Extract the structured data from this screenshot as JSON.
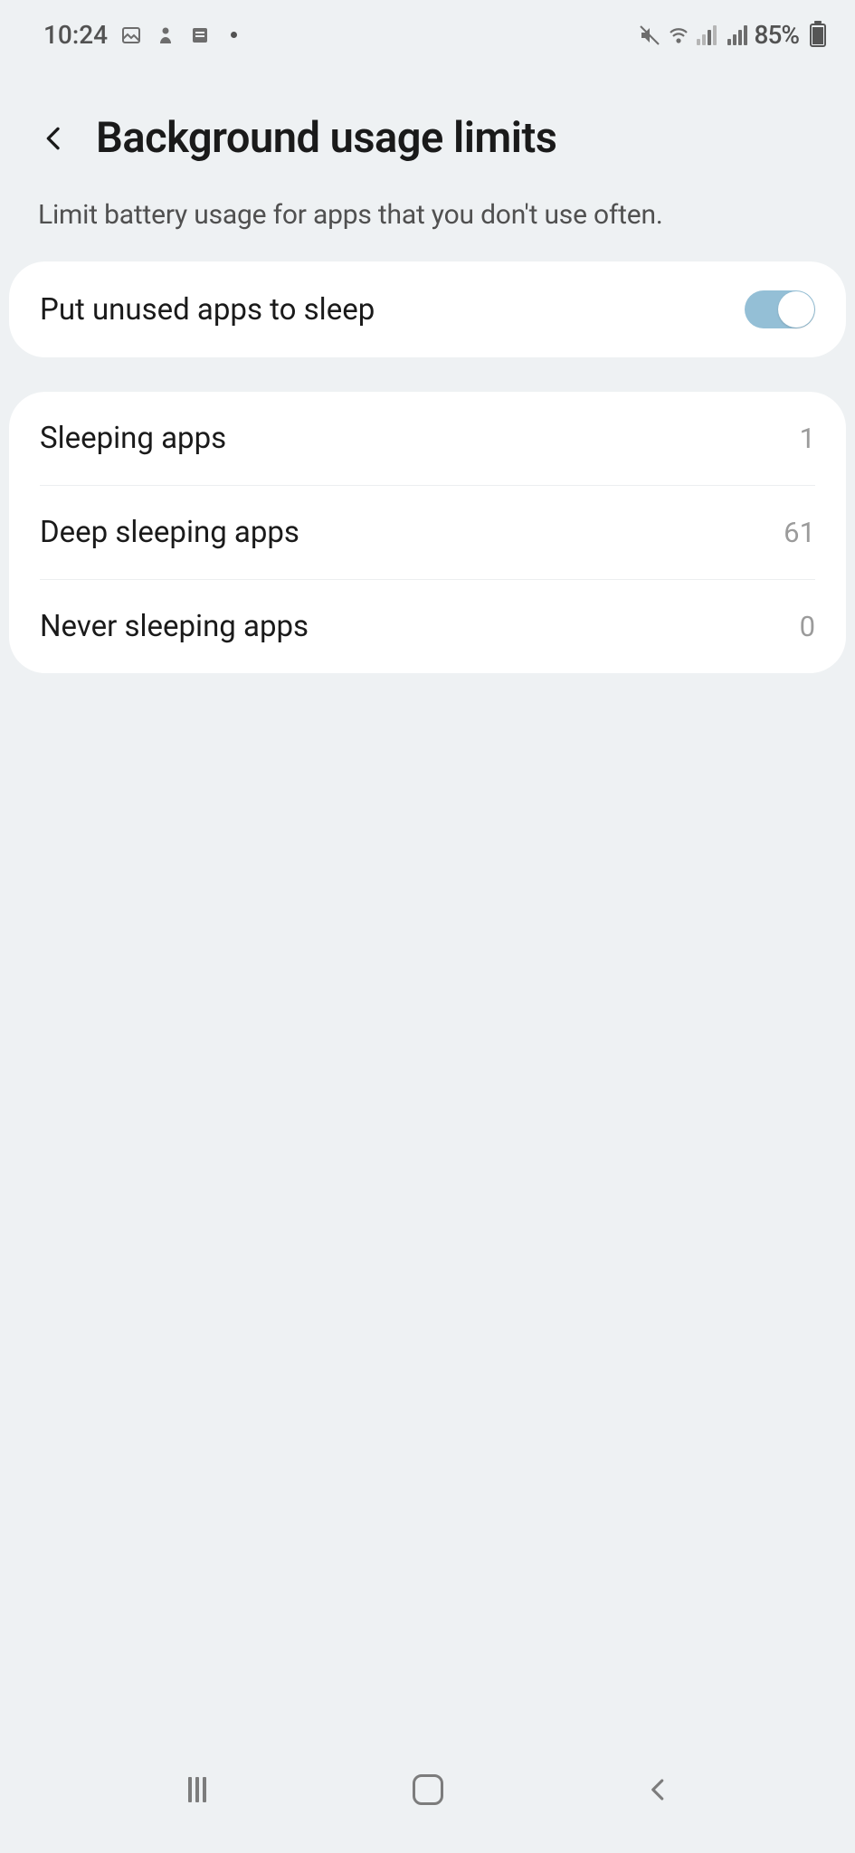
{
  "status": {
    "time": "10:24",
    "battery_percent": "85%"
  },
  "header": {
    "title": "Background usage limits",
    "subtitle": "Limit battery usage for apps that you don't use often."
  },
  "toggle_section": {
    "put_unused_apps_to_sleep": {
      "label": "Put unused apps to sleep",
      "enabled": true
    }
  },
  "app_lists": [
    {
      "label": "Sleeping apps",
      "count": "1"
    },
    {
      "label": "Deep sleeping apps",
      "count": "61"
    },
    {
      "label": "Never sleeping apps",
      "count": "0"
    }
  ]
}
